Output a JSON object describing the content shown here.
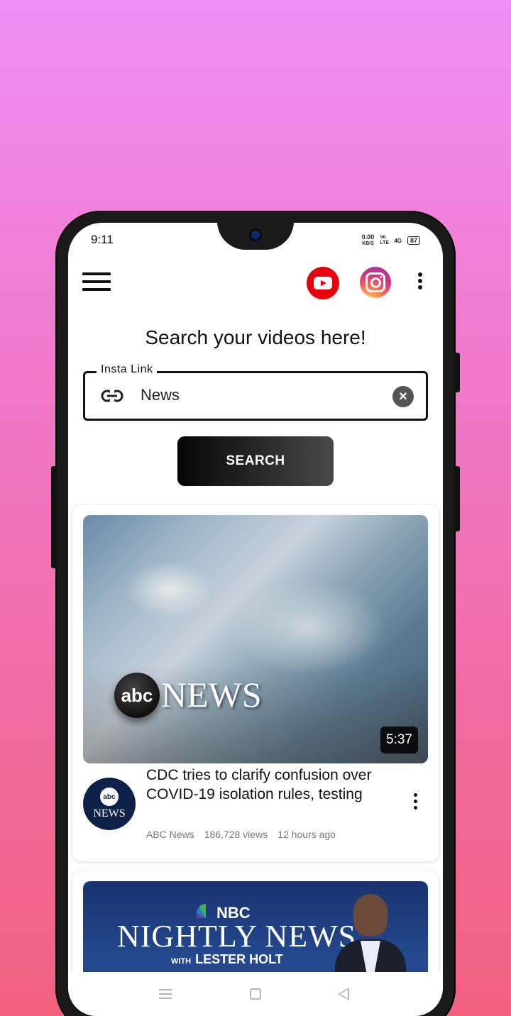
{
  "status_bar": {
    "time": "9:11",
    "net_speed": "0.00",
    "net_unit": "KB/S",
    "volte": "Vo LTE",
    "signal": "4G",
    "battery": "87"
  },
  "app_bar": {
    "menu_icon": "hamburger-icon",
    "youtube_icon": "youtube-icon",
    "instagram_icon": "instagram-icon",
    "more_icon": "more-vertical-icon"
  },
  "main": {
    "heading": "Search your videos here!",
    "input_label": "Insta Link",
    "input_value": "News",
    "search_button": "SEARCH"
  },
  "videos": [
    {
      "duration": "5:37",
      "title": "CDC tries to clarify confusion over COVID-19 isolation rules, testing",
      "channel": "ABC News",
      "views": "186,728 views",
      "time_ago": "12 hours ago",
      "thumb_brand_logo": "abc",
      "thumb_brand_text": "NEWS",
      "avatar_logo": "abc",
      "avatar_text": "NEWS"
    },
    {
      "thumb_brand_text": "NBC",
      "thumb_title": "NIGHTLY NEWS",
      "thumb_with": "WITH",
      "thumb_host": "LESTER HOLT"
    }
  ],
  "colors": {
    "youtube": "#e8000c",
    "background_top": "#ef8ef5",
    "background_bottom": "#f2607e"
  }
}
